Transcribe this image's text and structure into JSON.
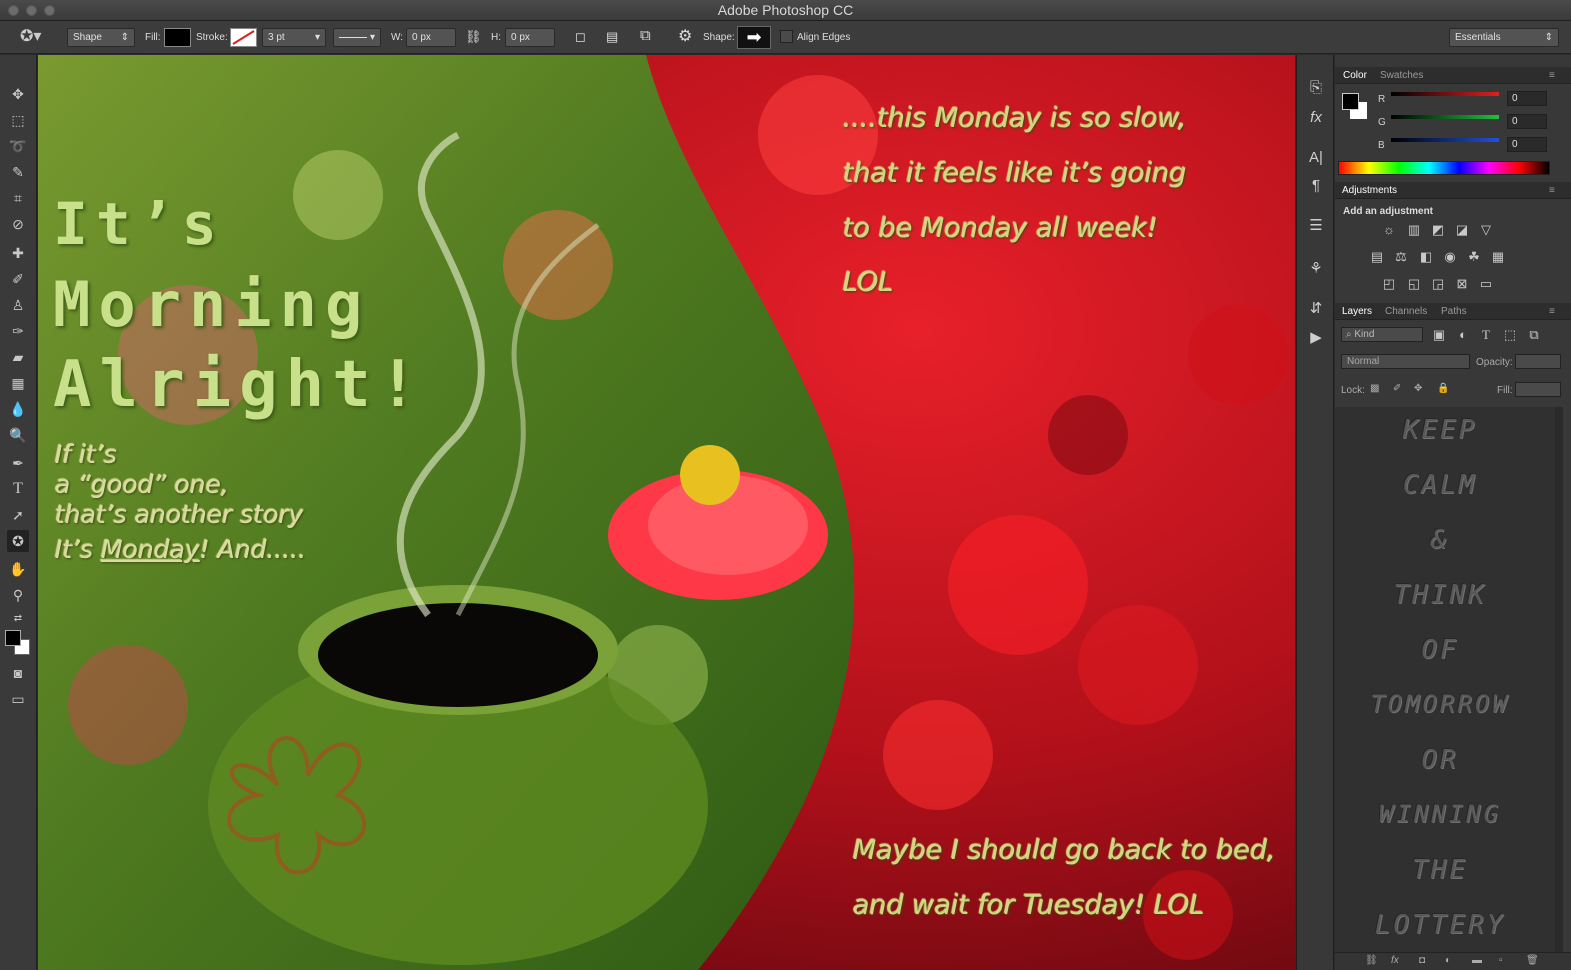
{
  "window": {
    "title": "Adobe Photoshop CC"
  },
  "options": {
    "mode": "Shape",
    "fill_label": "Fill:",
    "stroke_label": "Stroke:",
    "stroke_width": "3 pt",
    "w_label": "W:",
    "w_value": "0 px",
    "h_label": "H:",
    "h_value": "0 px",
    "shape_label": "Shape:",
    "align_edges": "Align Edges",
    "workspace": "Essentials"
  },
  "canvas": {
    "title_lines": [
      "It’s",
      "Morning",
      "Alright!"
    ],
    "left_lines": [
      "If it’s",
      "a “good” one,",
      "that’s another story",
      "It’s ",
      "Monday",
      "! And....."
    ],
    "right_top_lines": [
      "....this Monday is so slow,",
      "that it feels like it’s going",
      "to be Monday all week!",
      "LOL"
    ],
    "right_bottom_lines": [
      "Maybe I should go back to bed,",
      "and wait for Tuesday! LOL"
    ]
  },
  "color_panel": {
    "tabs": [
      "Color",
      "Swatches"
    ],
    "r_label": "R",
    "g_label": "G",
    "b_label": "B",
    "r_value": "0",
    "g_value": "0",
    "b_value": "0"
  },
  "adjustments_panel": {
    "tab": "Adjustments",
    "heading": "Add an adjustment"
  },
  "layers_panel": {
    "tabs": [
      "Layers",
      "Channels",
      "Paths"
    ],
    "filter_kind": "Kind",
    "blend_mode": "Normal",
    "opacity_label": "Opacity:",
    "lock_label": "Lock:",
    "fill_label": "Fill:",
    "thumbnail_text": [
      "KEEP",
      "CALM",
      "&",
      "THINK",
      "OF",
      "TOMORROW",
      "OR",
      "WINNING",
      "THE",
      "LOTTERY"
    ]
  },
  "colors": {
    "chrome_bg": "#383838",
    "red_slider": "#e02020",
    "green_slider": "#20c040",
    "blue_slider": "#2050e0"
  }
}
